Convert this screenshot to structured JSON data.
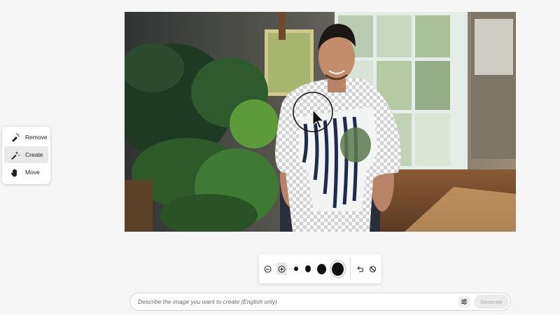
{
  "tools": {
    "items": [
      {
        "label": "Remove",
        "icon": "remove-brush-icon",
        "active": false
      },
      {
        "label": "Create",
        "icon": "create-brush-icon",
        "active": true
      },
      {
        "label": "Move",
        "icon": "hand-icon",
        "active": false
      }
    ]
  },
  "canvas": {
    "image": "photo of a man in a patterned shirt standing by a window with monstera plants; shirt area masked with transparency checkerboard",
    "cursor": "brush-cursor-icon"
  },
  "brush_toolbar": {
    "subtract_icon": "minus-circle-icon",
    "add_icon": "plus-circle-icon",
    "undo_icon": "undo-icon",
    "clear_icon": "clear-icon"
  },
  "prompt": {
    "placeholder": "Describe the image you want to create (English only)",
    "settings_icon": "sliders-icon",
    "generate_label": "Generate"
  }
}
